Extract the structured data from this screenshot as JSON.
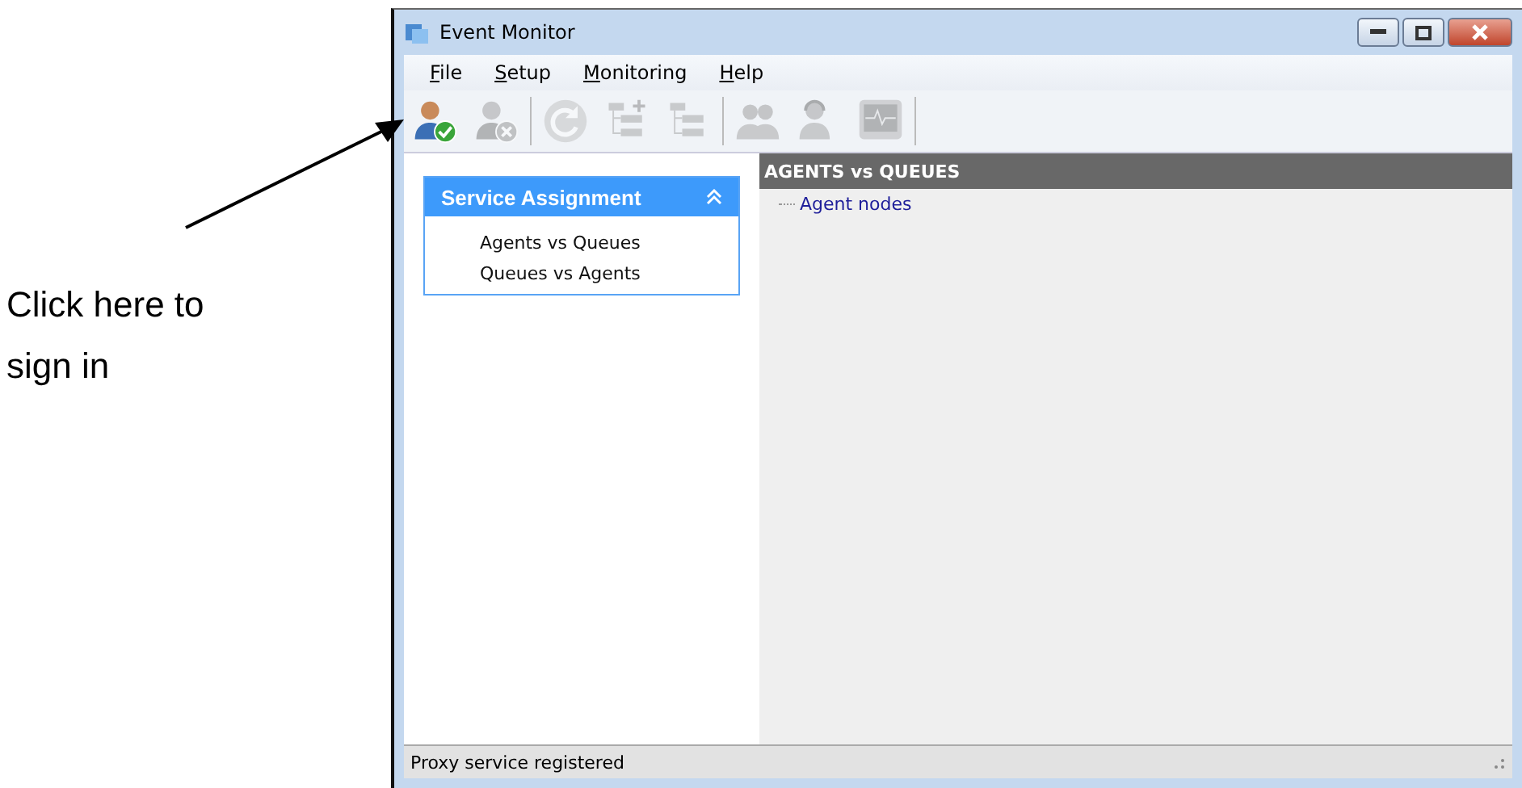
{
  "annotation": {
    "text": "Click here to sign in"
  },
  "window": {
    "title": "Event Monitor"
  },
  "menu": [
    {
      "label": "File"
    },
    {
      "label": "Setup"
    },
    {
      "label": "Monitoring"
    },
    {
      "label": "Help"
    }
  ],
  "toolbar": [
    {
      "kind": "sign-in",
      "disabled": false
    },
    {
      "kind": "sign-out",
      "disabled": true
    },
    {
      "kind": "separator"
    },
    {
      "kind": "refresh",
      "disabled": true
    },
    {
      "kind": "tree-add",
      "disabled": true
    },
    {
      "kind": "tree",
      "disabled": true
    },
    {
      "kind": "separator"
    },
    {
      "kind": "agents",
      "disabled": true
    },
    {
      "kind": "headset",
      "disabled": true
    },
    {
      "kind": "monitor",
      "disabled": true
    },
    {
      "kind": "separator"
    }
  ],
  "sidebar": {
    "title": "Service Assignment",
    "expanded": true,
    "items": [
      {
        "label": "Agents vs Queues"
      },
      {
        "label": "Queues vs Agents"
      }
    ]
  },
  "panel": {
    "title": "AGENTS vs QUEUES",
    "tree": [
      {
        "label": "Agent nodes"
      }
    ]
  },
  "status_bar": {
    "text": "Proxy service registered"
  }
}
